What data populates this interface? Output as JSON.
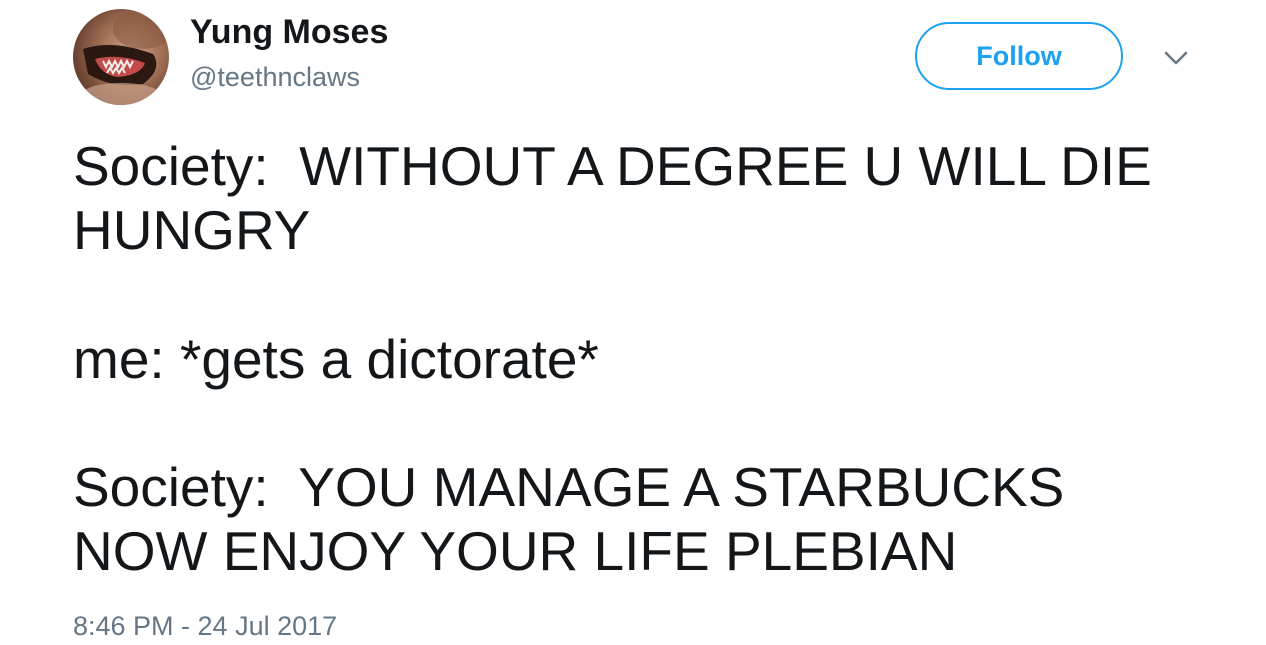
{
  "author": {
    "display_name": "Yung Moses",
    "handle": "@teethnclaws",
    "avatar_icon": "dog-teeth-avatar"
  },
  "actions": {
    "follow_label": "Follow",
    "more_icon": "chevron-down-icon"
  },
  "tweet": {
    "paragraphs": [
      "Society:  WITHOUT A DEGREE U WILL DIE HUNGRY",
      "me: *gets a dictorate*",
      "Society:  YOU MANAGE A STARBUCKS NOW ENJOY YOUR LIFE PLEBIAN"
    ],
    "timestamp": "8:46 PM - 24 Jul 2017"
  },
  "colors": {
    "accent": "#1da1f2",
    "text": "#14171a",
    "muted": "#657786"
  }
}
